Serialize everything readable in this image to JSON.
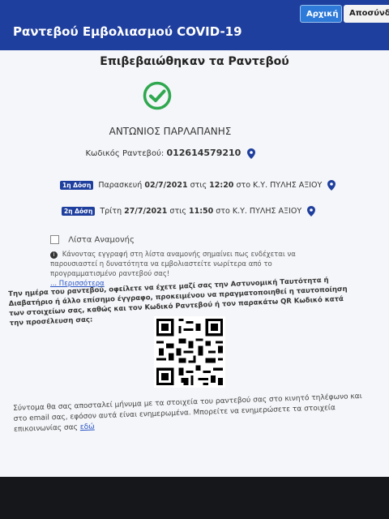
{
  "navbar": {
    "brand": "Ραντεβού Εμβολιασμού COVID-19",
    "home_label": "Αρχική",
    "logout_label": "Αποσύνδεση"
  },
  "confirmation": {
    "title": "Επιβεβαιώθηκαν τα Ραντεβού",
    "name": "ΑΝΤΩΝΙΟΣ ΠΑΡΛΑΠΑΝΗΣ",
    "code_label": "Κωδικός Ραντεβού:",
    "code_value": "012614579210"
  },
  "doses": [
    {
      "badge": "1η Δόση",
      "day": "Παρασκευή",
      "date": "02/7/2021",
      "at": "στις",
      "time": "12:20",
      "place": "στο Κ.Υ. ΠΥΛΗΣ ΑΞΙΟΥ"
    },
    {
      "badge": "2η Δόση",
      "day": "Τρίτη",
      "date": "27/7/2021",
      "at": "στις",
      "time": "11:50",
      "place": "στο Κ.Υ. ΠΥΛΗΣ ΑΞΙΟΥ"
    }
  ],
  "waitlist": {
    "label": "Λίστα Αναμονής",
    "info": "Κάνοντας εγγραφή στη λίστα αναμονής σημαίνει πως ενδέχεται να παρουσιαστεί η δυνατότητα να εμβολιαστείτε νωρίτερα από το προγραμματισμένο ραντεβού σας!",
    "more": "... Περισσότερα"
  },
  "instructions": "Την ημέρα του ραντεβού, οφείλετε να έχετε μαζί σας την Αστυνομική Ταυτότητα ή Διαβατήριο ή άλλο επίσημο έγγραφο, προκειμένου να πραγματοποιηθεί η ταυτοποίηση των στοιχείων σας, καθώς και τον Κωδικό Ραντεβού ή τον παρακάτω QR Κωδικό κατά την προσέλευση σας:",
  "footer": {
    "text": "Σύντομα θα σας αποσταλεί μήνυμα με τα στοιχεία του ραντεβού σας στο κινητό τηλέφωνο και στο email σας, εφόσον αυτά είναι ενημερωμένα. Μπορείτε να ενημερώσετε τα στοιχεία επικοινωνίας σας",
    "link": "εδώ"
  },
  "colors": {
    "brand": "#1f3f9e",
    "check": "#2fa84f",
    "pin": "#1f3f9e"
  },
  "icons": {
    "check": "check-circle-icon",
    "pin": "map-pin-icon",
    "info": "info-icon"
  }
}
